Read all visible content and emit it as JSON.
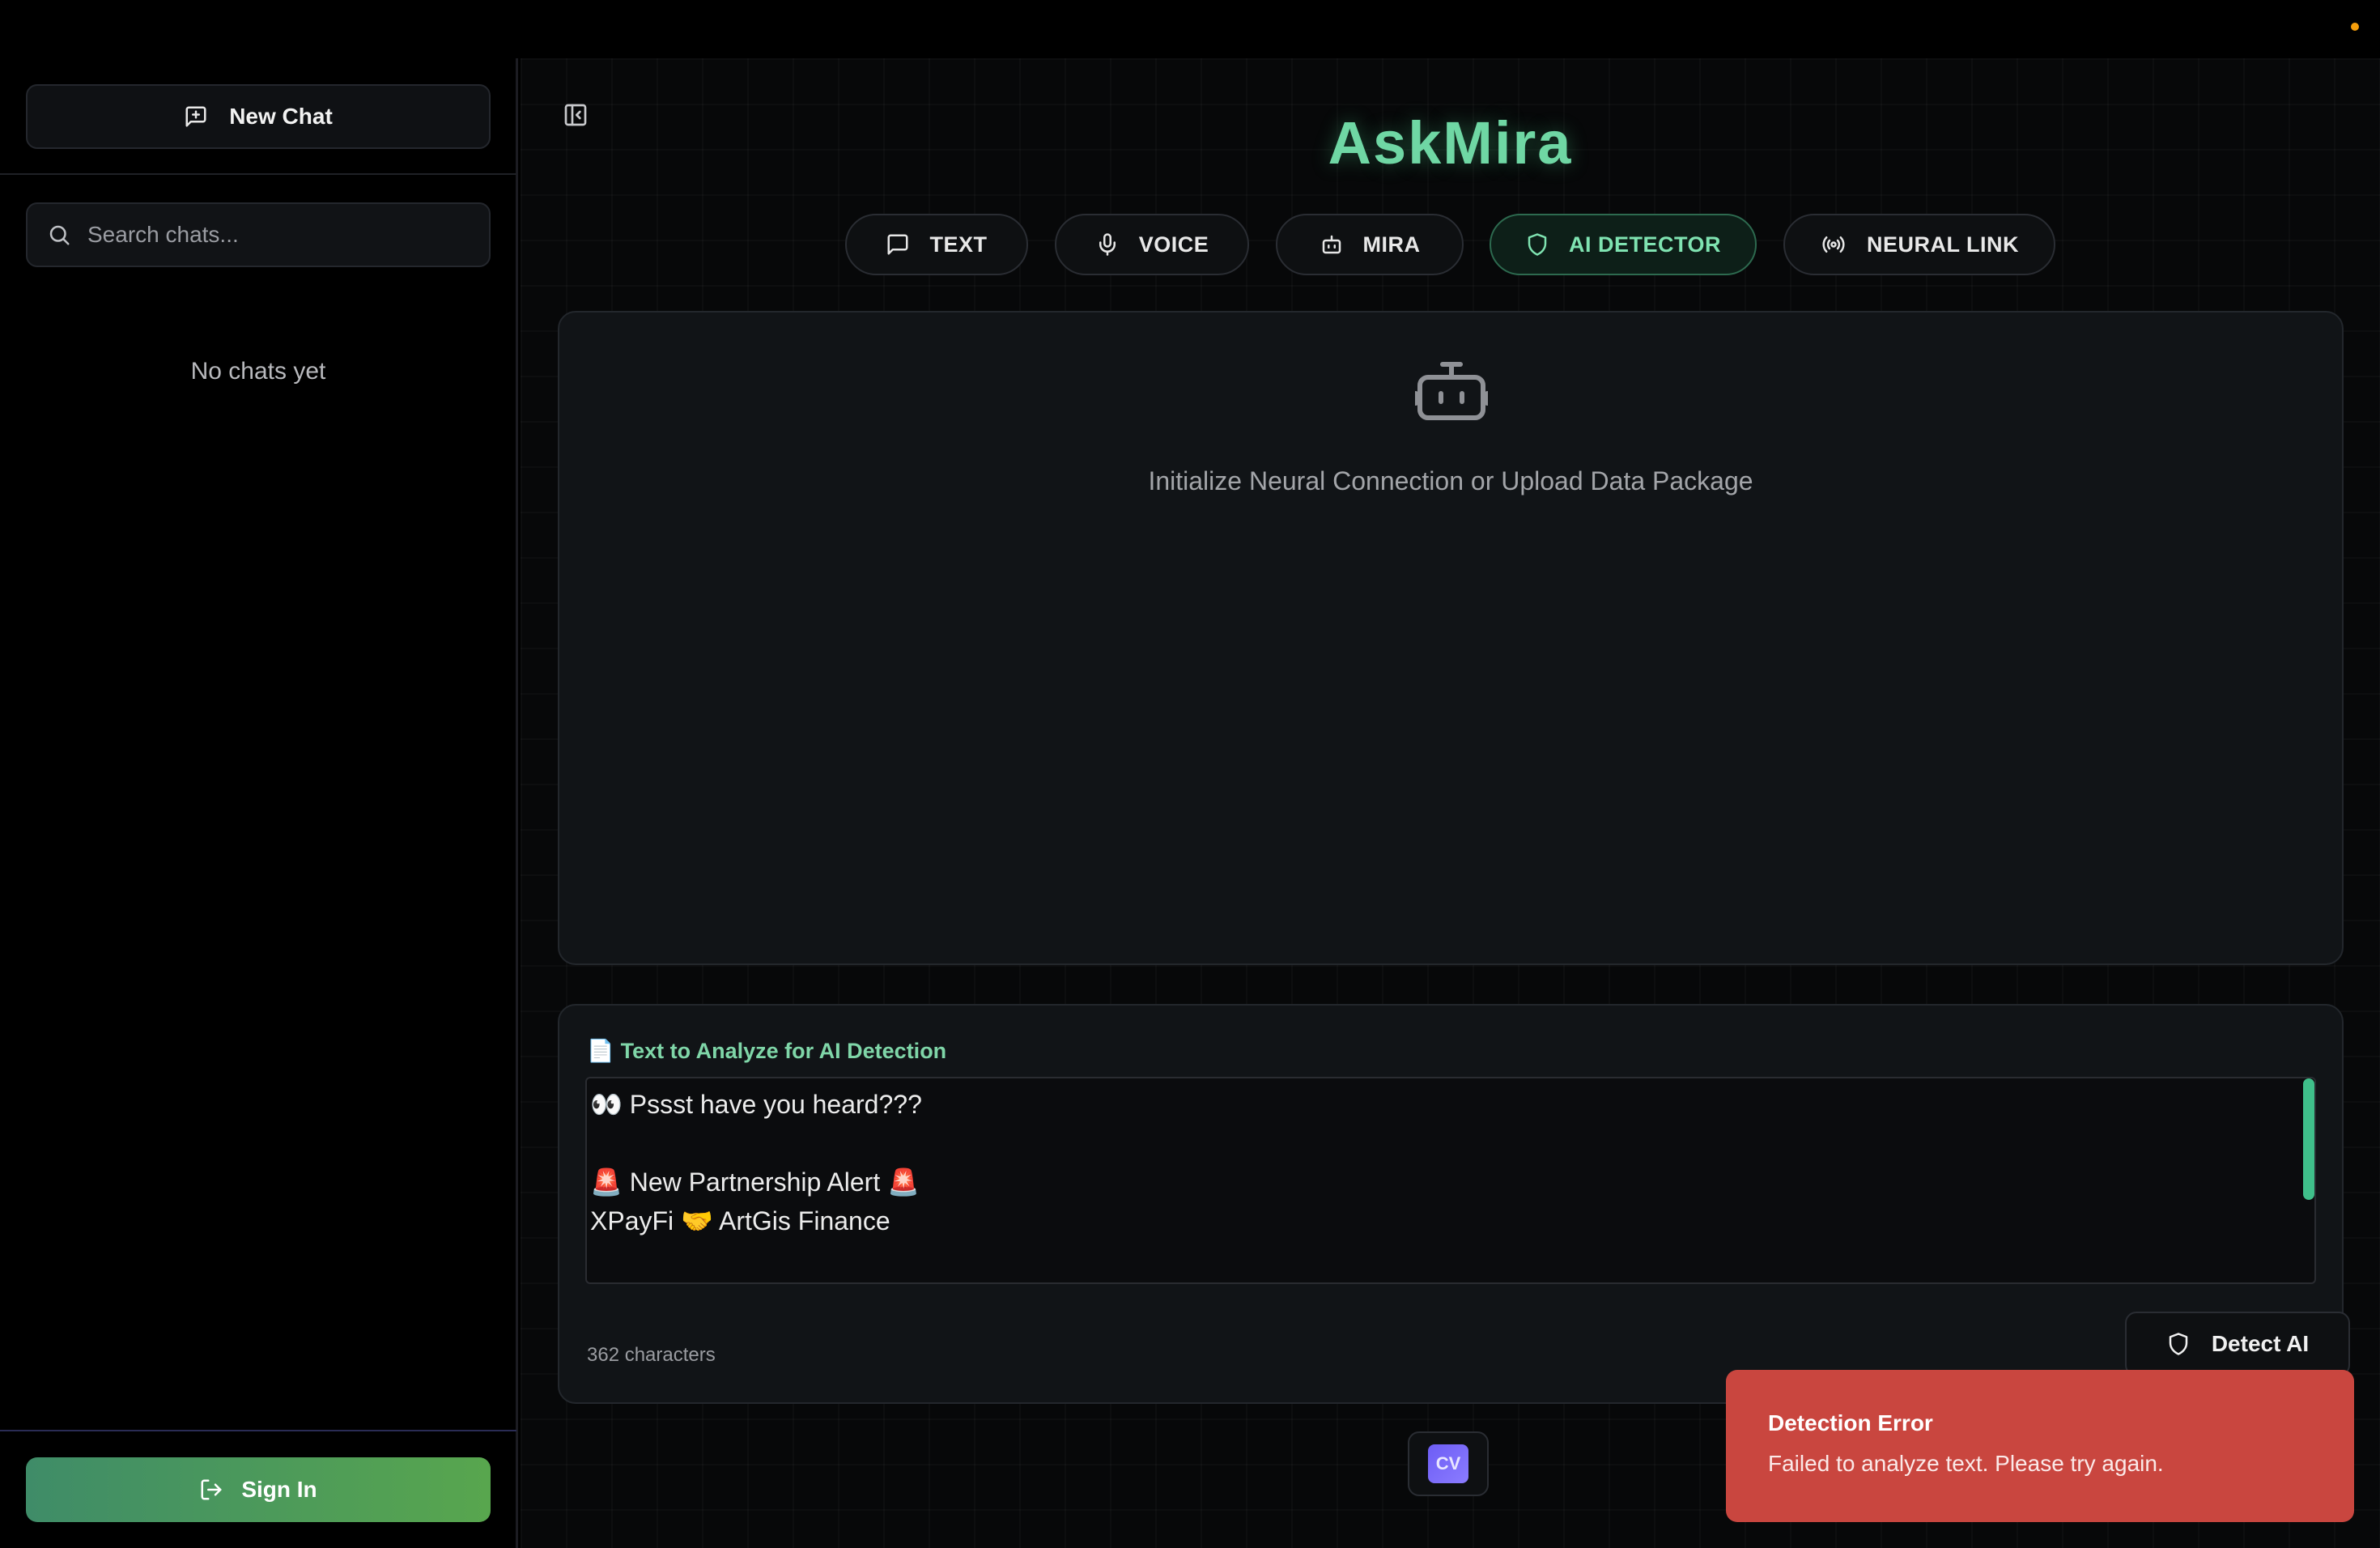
{
  "sidebar": {
    "new_chat_label": "New Chat",
    "search_placeholder": "Search chats...",
    "empty_text": "No chats yet",
    "sign_in_label": "Sign In"
  },
  "header": {
    "brand": "AskMira"
  },
  "tabs": [
    {
      "label": "TEXT",
      "icon": "message-square-icon",
      "active": false
    },
    {
      "label": "VOICE",
      "icon": "microphone-icon",
      "active": false
    },
    {
      "label": "MIRA",
      "icon": "bot-icon",
      "active": false
    },
    {
      "label": "AI DETECTOR",
      "icon": "shield-icon",
      "active": true
    },
    {
      "label": "NEURAL LINK",
      "icon": "radio-signal-icon",
      "active": false
    }
  ],
  "panel": {
    "icon": "robot-icon",
    "message": "Initialize Neural Connection or Upload Data Package"
  },
  "detector": {
    "label_icon": "📄",
    "label": "Text to Analyze for AI Detection",
    "text_lines": [
      "👀 Pssst have you heard???",
      "",
      "🚨 New Partnership Alert 🚨",
      "XPayFi 🤝 ArtGis Finance"
    ],
    "char_count": "362 characters",
    "detect_button_label": "Detect AI"
  },
  "footer": {
    "badge_text": "CV"
  },
  "toast": {
    "title": "Detection Error",
    "message": "Failed to analyze text. Please try again."
  },
  "colors": {
    "accent": "#6fd7a4",
    "sign_in_gradient_start": "#3f8c68",
    "sign_in_gradient_end": "#58a64e",
    "error": "#c9463f",
    "badge": "#6d5df5"
  }
}
